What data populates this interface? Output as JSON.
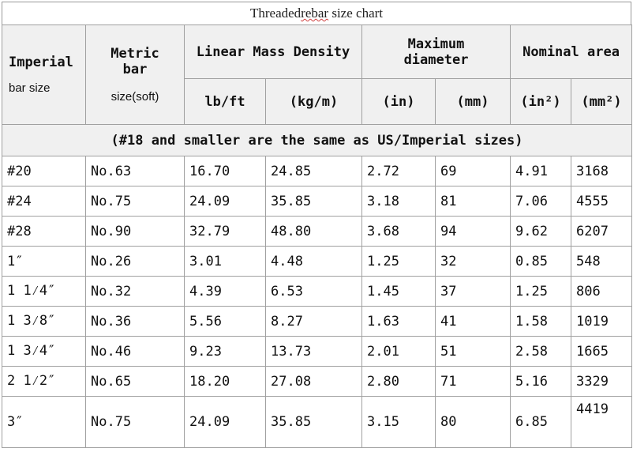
{
  "title_prefix": "Threaded",
  "title_squig": "rebar",
  "title_suffix": " size chart",
  "headers": {
    "imperial_line1": "Imperial",
    "imperial_line2": "bar size",
    "metric_line1": "Metric",
    "metric_line2": "bar",
    "metric_line3": "size(soft)",
    "linear_mass": "Linear Mass Density",
    "max_diameter_line1": "Maximum",
    "max_diameter_line2": "diameter",
    "nominal_area": "Nominal area",
    "unit_lbft": "lb/ft",
    "unit_kgm": "(kg/m)",
    "unit_in": "(in)",
    "unit_mm": "(mm)",
    "unit_in2": "(in²)",
    "unit_mm2": "(mm²)"
  },
  "note": "(#18 and smaller are the same as US/Imperial sizes)",
  "rows": [
    {
      "imperial": "#20",
      "metric": "No.63",
      "lbft": "16.70",
      "kgm": "24.85",
      "in": "2.72",
      "mm": "69",
      "in2": "4.91",
      "mm2": "3168"
    },
    {
      "imperial": "#24",
      "metric": "No.75",
      "lbft": "24.09",
      "kgm": "35.85",
      "in": "3.18",
      "mm": "81",
      "in2": "7.06",
      "mm2": "4555"
    },
    {
      "imperial": "#28",
      "metric": "No.90",
      "lbft": "32.79",
      "kgm": "48.80",
      "in": "3.68",
      "mm": "94",
      "in2": "9.62",
      "mm2": "6207"
    },
    {
      "imperial": "1″",
      "metric": "No.26",
      "lbft": "3.01",
      "kgm": "4.48",
      "in": "1.25",
      "mm": "32",
      "in2": "0.85",
      "mm2": "548"
    },
    {
      "imperial": "1  1⁄4″",
      "metric": "No.32",
      "lbft": "4.39",
      "kgm": "6.53",
      "in": "1.45",
      "mm": "37",
      "in2": "1.25",
      "mm2": "806"
    },
    {
      "imperial": "1  3⁄8″",
      "metric": "No.36",
      "lbft": "5.56",
      "kgm": "8.27",
      "in": "1.63",
      "mm": "41",
      "in2": "1.58",
      "mm2": "1019"
    },
    {
      "imperial": "1  3⁄4″",
      "metric": "No.46",
      "lbft": "9.23",
      "kgm": "13.73",
      "in": "2.01",
      "mm": "51",
      "in2": "2.58",
      "mm2": "1665"
    },
    {
      "imperial": "2  1⁄2″",
      "metric": "No.65",
      "lbft": "18.20",
      "kgm": "27.08",
      "in": "2.80",
      "mm": "71",
      "in2": "5.16",
      "mm2": "3329"
    },
    {
      "imperial": "3″",
      "metric": "No.75",
      "lbft": "24.09",
      "kgm": "35.85",
      "in": "3.15",
      "mm": "80",
      "in2": "6.85",
      "mm2": "4419"
    }
  ]
}
